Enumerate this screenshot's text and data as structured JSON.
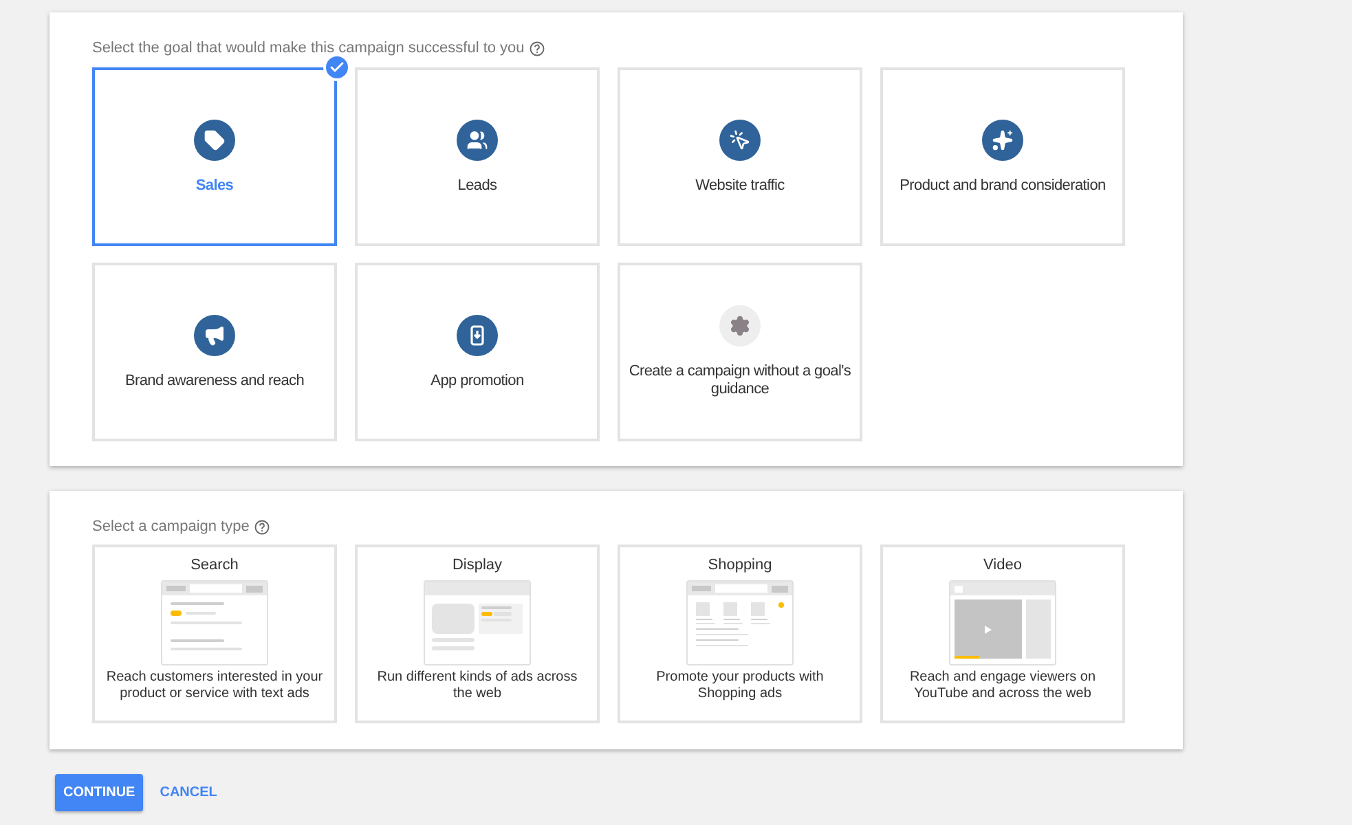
{
  "goal_section": {
    "heading": "Select the goal that would make this campaign successful to you",
    "goals": [
      {
        "kind": "sales",
        "label": "Sales",
        "selected": true
      },
      {
        "kind": "leads",
        "label": "Leads",
        "selected": false
      },
      {
        "kind": "traffic",
        "label": "Website traffic",
        "selected": false
      },
      {
        "kind": "consideration",
        "label": "Product and brand consideration",
        "selected": false
      },
      {
        "kind": "awareness",
        "label": "Brand awareness and reach",
        "selected": false
      },
      {
        "kind": "app",
        "label": "App promotion",
        "selected": false
      },
      {
        "kind": "none",
        "label": "Create a campaign without a goal's guidance",
        "selected": false
      }
    ]
  },
  "type_section": {
    "heading": "Select a campaign type",
    "types": [
      {
        "kind": "search",
        "title": "Search",
        "description": "Reach customers interested in your product or service with text ads"
      },
      {
        "kind": "display",
        "title": "Display",
        "description": "Run different kinds of ads across the web"
      },
      {
        "kind": "shopping",
        "title": "Shopping",
        "description": "Promote your products with Shopping ads"
      },
      {
        "kind": "video",
        "title": "Video",
        "description": "Reach and engage viewers on YouTube and across the web"
      }
    ]
  },
  "actions": {
    "continue": "CONTINUE",
    "cancel": "CANCEL"
  }
}
